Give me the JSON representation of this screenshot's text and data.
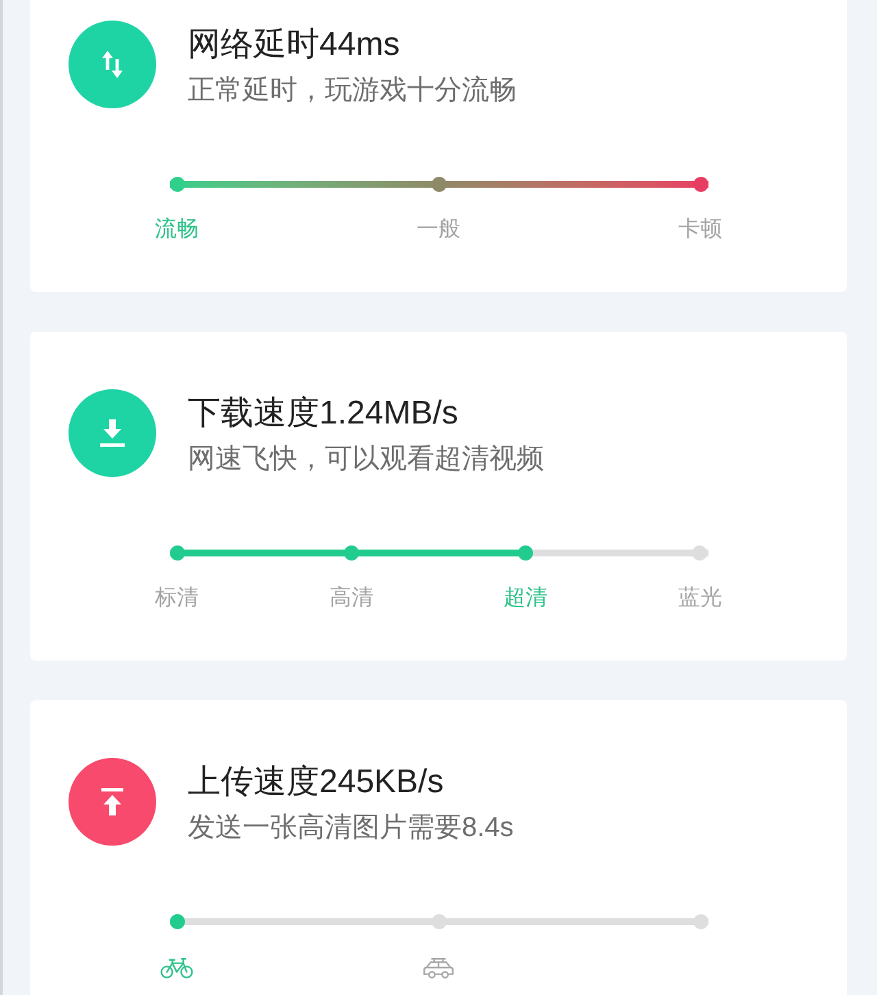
{
  "cards": [
    {
      "kind": "latency",
      "color": "#1fd4a4",
      "title": "网络延时44ms",
      "subtitle": "正常延时，玩游戏十分流畅",
      "scale": {
        "kind": "gradient",
        "stops": [
          {
            "kind": "text",
            "label": "流畅",
            "selected": true
          },
          {
            "kind": "text",
            "label": "一般",
            "selected": false
          },
          {
            "kind": "text",
            "label": "卡顿",
            "selected": false
          }
        ]
      }
    },
    {
      "kind": "download",
      "color": "#1fd4a4",
      "title": "下载速度1.24MB/s",
      "subtitle": "网速飞快，可以观看超清视频",
      "scale": {
        "kind": "steps",
        "level": 0.667,
        "stops": [
          {
            "kind": "text",
            "label": "标清",
            "selected": false
          },
          {
            "kind": "text",
            "label": "高清",
            "selected": false
          },
          {
            "kind": "text",
            "label": "超清",
            "selected": true
          },
          {
            "kind": "text",
            "label": "蓝光",
            "selected": false
          }
        ]
      }
    },
    {
      "kind": "upload",
      "color": "#f74a6c",
      "title": "上传速度245KB/s",
      "subtitle": "发送一张高清图片需要8.4s",
      "scale": {
        "kind": "steps",
        "stops": [
          {
            "kind": "bicycle",
            "selected": true
          },
          {
            "kind": "car",
            "selected": false
          },
          {
            "selected": false
          }
        ]
      }
    }
  ]
}
